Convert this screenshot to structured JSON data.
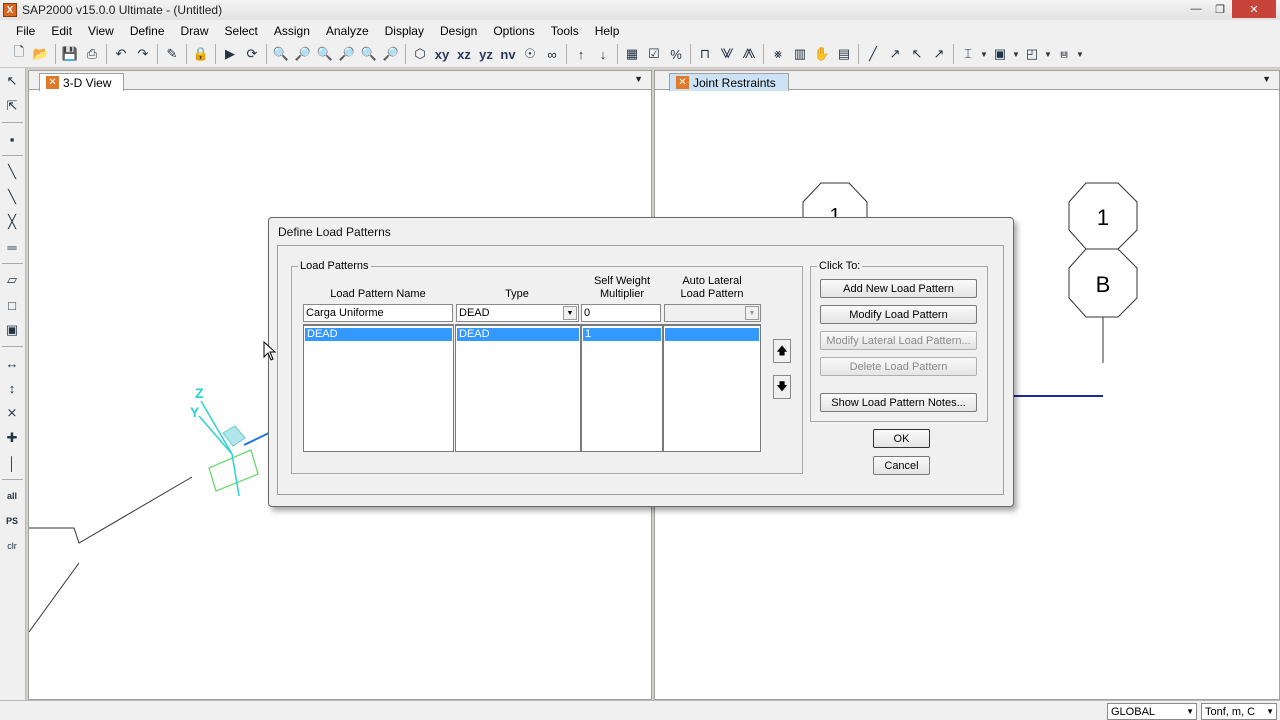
{
  "window": {
    "title": "SAP2000 v15.0.0 Ultimate  - (Untitled)",
    "app_icon": "X"
  },
  "menu": [
    "File",
    "Edit",
    "View",
    "Define",
    "Draw",
    "Select",
    "Assign",
    "Analyze",
    "Display",
    "Design",
    "Options",
    "Tools",
    "Help"
  ],
  "toolbar": {
    "view_labels": [
      "xy",
      "xz",
      "yz",
      "nv"
    ]
  },
  "panes": {
    "left": {
      "tab": "3-D View"
    },
    "right": {
      "tab": "Joint Restraints",
      "grid_labels": [
        "1",
        "B",
        "1"
      ]
    }
  },
  "axes": {
    "z": "Z",
    "y": "Y"
  },
  "dialog": {
    "title": "Define Load Patterns",
    "group_label": "Load Patterns",
    "columns": {
      "name": "Load Pattern Name",
      "type": "Type",
      "self_weight_1": "Self Weight",
      "self_weight_2": "Multiplier",
      "auto_lateral_1": "Auto Lateral",
      "auto_lateral_2": "Load Pattern"
    },
    "input": {
      "name": "Carga Uniforme",
      "type": "DEAD",
      "multiplier": "0",
      "auto_lateral": ""
    },
    "rows": [
      {
        "name": "DEAD",
        "type": "DEAD",
        "multiplier": "1",
        "auto_lateral": ""
      }
    ],
    "click_to_label": "Click To:",
    "buttons": {
      "add": "Add New Load Pattern",
      "modify": "Modify Load Pattern",
      "modify_lateral": "Modify Lateral Load Pattern...",
      "delete": "Delete Load Pattern",
      "notes": "Show Load Pattern Notes...",
      "ok": "OK",
      "cancel": "Cancel"
    }
  },
  "status": {
    "coord_system": "GLOBAL",
    "units": "Tonf, m, C"
  }
}
